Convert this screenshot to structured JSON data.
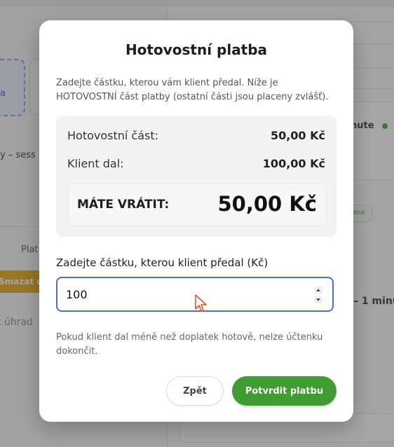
{
  "background": {
    "left_card_label": "a",
    "left_session_text": "y – sess",
    "left_column_header": "Plat",
    "delete_button_label": "Smazat ú",
    "payment_text": "t úhrad",
    "right_minute_text": "nute",
    "right_volne_badge": "olné",
    "right_minute_text2": "– 1 minu"
  },
  "modal": {
    "title": "Hotovostní platba",
    "description": "Zadejte částku, kterou vám klient předal. Níže je HOTOVOSTNÍ část platby (ostatní části jsou placeny zvlášť).",
    "summary": {
      "cash_part_label": "Hotovostní část:",
      "cash_part_value": "50,00 Kč",
      "client_gave_label": "Klient dal:",
      "client_gave_value": "100,00 Kč",
      "change_label": "MÁTE VRÁTIT:",
      "change_value": "50,00 Kč"
    },
    "input_label": "Zadejte částku, kterou klient předal (Kč)",
    "input_value": "100",
    "hint": "Pokud klient dal méně než doplatek hotově, nelze účtenku dokončit.",
    "back_button": "Zpět",
    "confirm_button": "Potvrdit platbu"
  },
  "colors": {
    "accent_blue": "#4a6fd4",
    "confirm_green": "#3f9c30"
  }
}
